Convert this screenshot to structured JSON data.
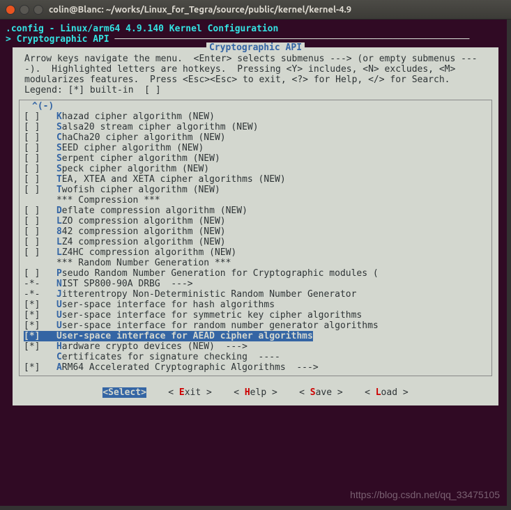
{
  "titlebar": "colin@Blanc: ~/works/Linux_for_Tegra/source/public/kernel/kernel-4.9",
  "header_line": ".config - Linux/arm64 4.9.140 Kernel Configuration",
  "breadcrumb_prefix": "> ",
  "breadcrumb": "Cryptographic API",
  "box_title": "Cryptographic API",
  "help_text": "Arrow keys navigate the menu.  <Enter> selects submenus ---> (or empty submenus ----).  Highlighted letters are hotkeys.  Pressing <Y> includes, <N> excludes, <M> modularizes features.  Press <Esc><Esc> to exit, <?> for Help, </> for Search.  Legend: [*] built-in  [ ]",
  "scroll_hint": "^(-)",
  "items": [
    {
      "mark": "[ ]",
      "hot": "K",
      "text": "hazad cipher algorithm (NEW)"
    },
    {
      "mark": "[ ]",
      "hot": "S",
      "text": "alsa20 stream cipher algorithm (NEW)"
    },
    {
      "mark": "[ ]",
      "hot": "C",
      "text": "haCha20 cipher algorithm (NEW)"
    },
    {
      "mark": "[ ]",
      "hot": "S",
      "text": "EED cipher algorithm (NEW)"
    },
    {
      "mark": "[ ]",
      "hot": "S",
      "text": "erpent cipher algorithm (NEW)"
    },
    {
      "mark": "[ ]",
      "hot": "S",
      "text": "peck cipher algorithm (NEW)"
    },
    {
      "mark": "[ ]",
      "hot": "T",
      "text": "EA, XTEA and XETA cipher algorithms (NEW)"
    },
    {
      "mark": "[ ]",
      "hot": "T",
      "text": "wofish cipher algorithm (NEW)"
    },
    {
      "mark": "   ",
      "hot": "",
      "text": "*** Compression ***"
    },
    {
      "mark": "[ ]",
      "hot": "D",
      "text": "eflate compression algorithm (NEW)"
    },
    {
      "mark": "[ ]",
      "hot": "L",
      "text": "ZO compression algorithm (NEW)"
    },
    {
      "mark": "[ ]",
      "hot": "8",
      "text": "42 compression algorithm (NEW)"
    },
    {
      "mark": "[ ]",
      "hot": "L",
      "text": "Z4 compression algorithm (NEW)"
    },
    {
      "mark": "[ ]",
      "hot": "L",
      "text": "Z4HC compression algorithm (NEW)"
    },
    {
      "mark": "   ",
      "hot": "",
      "text": "*** Random Number Generation ***"
    },
    {
      "mark": "[ ]",
      "hot": "P",
      "text": "seudo Random Number Generation for Cryptographic modules ("
    },
    {
      "mark": "-*-",
      "hot": "N",
      "text": "IST SP800-90A DRBG  --->"
    },
    {
      "mark": "-*-",
      "hot": "J",
      "text": "itterentropy Non-Deterministic Random Number Generator"
    },
    {
      "mark": "[*]",
      "hot": "U",
      "text": "ser-space interface for hash algorithms"
    },
    {
      "mark": "[*]",
      "hot": "U",
      "text": "ser-space interface for symmetric key cipher algorithms"
    },
    {
      "mark": "[*]",
      "hot": "U",
      "text": "ser-space interface for random number generator algorithms"
    },
    {
      "mark": "[*]",
      "hot": "U",
      "text": "ser-space interface for AEAD cipher algorithms",
      "selected": true
    },
    {
      "mark": "[*]",
      "hot": "H",
      "text": "ardware crypto devices (NEW)  --->"
    },
    {
      "mark": "   ",
      "hot": "C",
      "text": "ertificates for signature checking  ----"
    },
    {
      "mark": "[*]",
      "hot": "A",
      "text": "RM64 Accelerated Cryptographic Algorithms  --->"
    }
  ],
  "buttons": {
    "select": "<Select>",
    "exit_pre": "< ",
    "exit_hot": "E",
    "exit_post": "xit >",
    "help_pre": "< ",
    "help_hot": "H",
    "help_post": "elp >",
    "save_pre": "< ",
    "save_hot": "S",
    "save_post": "ave >",
    "load_pre": "< ",
    "load_hot": "L",
    "load_post": "oad >"
  },
  "watermark": "https://blog.csdn.net/qq_33475105"
}
